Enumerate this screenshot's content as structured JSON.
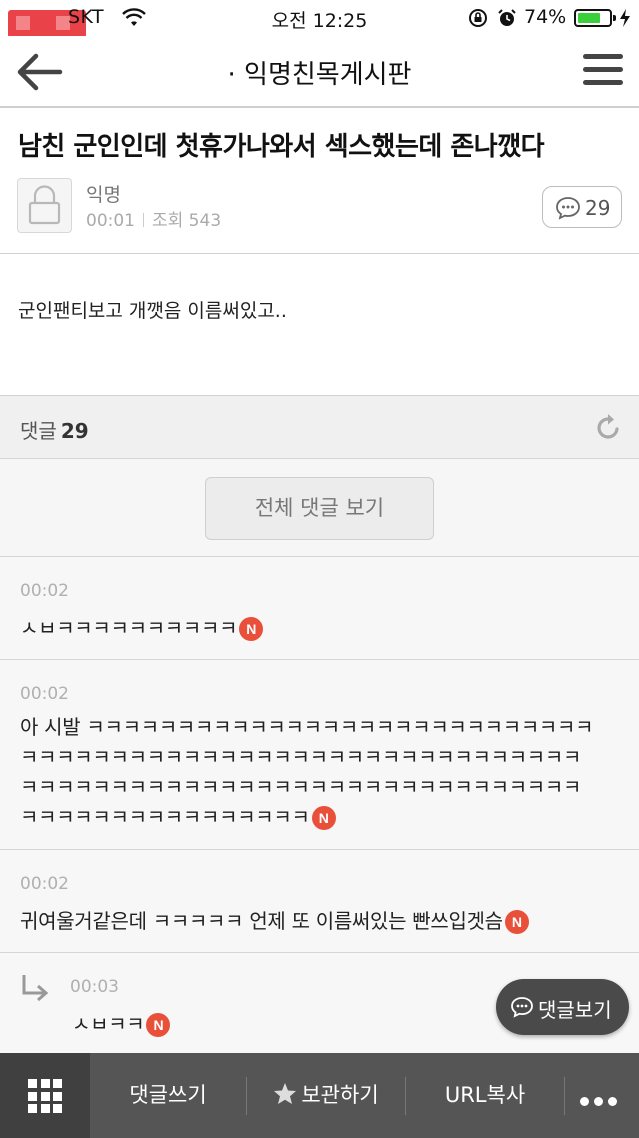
{
  "status_bar": {
    "carrier": "SKT",
    "time": "오전 12:25",
    "battery_percent": "74%",
    "battery_level": 0.74
  },
  "navbar": {
    "title": "· 익명친목게시판"
  },
  "post": {
    "title": "남친 군인인데 첫휴가나와서 섹스했는데 존나깼다",
    "author": "익명",
    "time": "00:01",
    "views_label": "조회 543",
    "comment_count": "29",
    "body": "군인팬티보고 개깻음 이름써있고.."
  },
  "comments_section": {
    "label": "댓글",
    "count": "29",
    "view_all_label": "전체 댓글 보기"
  },
  "comments": [
    {
      "time": "00:02",
      "lines": [
        "ㅅㅂㅋㅋㅋㅋㅋㅋㅋㅋㅋㅋ"
      ],
      "badge": "N",
      "reply": false
    },
    {
      "time": "00:02",
      "lines": [
        "아 시발 ㅋㅋㅋㅋㅋㅋㅋㅋㅋㅋㅋㅋㅋㅋㅋㅋㅋㅋㅋㅋㅋㅋㅋㅋㅋㅋㅋㅋ",
        "ㅋㅋㅋㅋㅋㅋㅋㅋㅋㅋㅋㅋㅋㅋㅋㅋㅋㅋㅋㅋㅋㅋㅋㅋㅋㅋㅋㅋㅋㅋㅋ",
        "ㅋㅋㅋㅋㅋㅋㅋㅋㅋㅋㅋㅋㅋㅋㅋㅋㅋㅋㅋㅋㅋㅋㅋㅋㅋㅋㅋㅋㅋㅋㅋ",
        "ㅋㅋㅋㅋㅋㅋㅋㅋㅋㅋㅋㅋㅋㅋㅋㅋ"
      ],
      "badge": "N",
      "reply": false
    },
    {
      "time": "00:02",
      "lines": [
        "귀여울거같은데 ㅋㅋㅋㅋㅋ 언제 또 이름써있는 빤쓰입겟슴"
      ],
      "badge": "N",
      "reply": false
    },
    {
      "time": "00:03",
      "lines": [
        "ㅅㅂㅋㅋ"
      ],
      "badge": "N",
      "reply": true
    }
  ],
  "floating_button": {
    "label": "댓글보기"
  },
  "toolbar": {
    "write_comment": "댓글쓰기",
    "bookmark": "보관하기",
    "copy_url": "URL복사"
  },
  "icons": {
    "back": "back-arrow-icon",
    "menu": "hamburger-menu-icon",
    "avatar": "lock-avatar-icon",
    "comment": "speech-bubble-icon",
    "refresh": "refresh-icon",
    "reply": "reply-arrow-icon",
    "grid": "grid-icon",
    "star": "star-icon",
    "more": "more-dots-icon"
  },
  "colors": {
    "new_badge": "#e8503a",
    "toolbar_bg": "#555555",
    "battery_fill": "#3ccf3c"
  }
}
